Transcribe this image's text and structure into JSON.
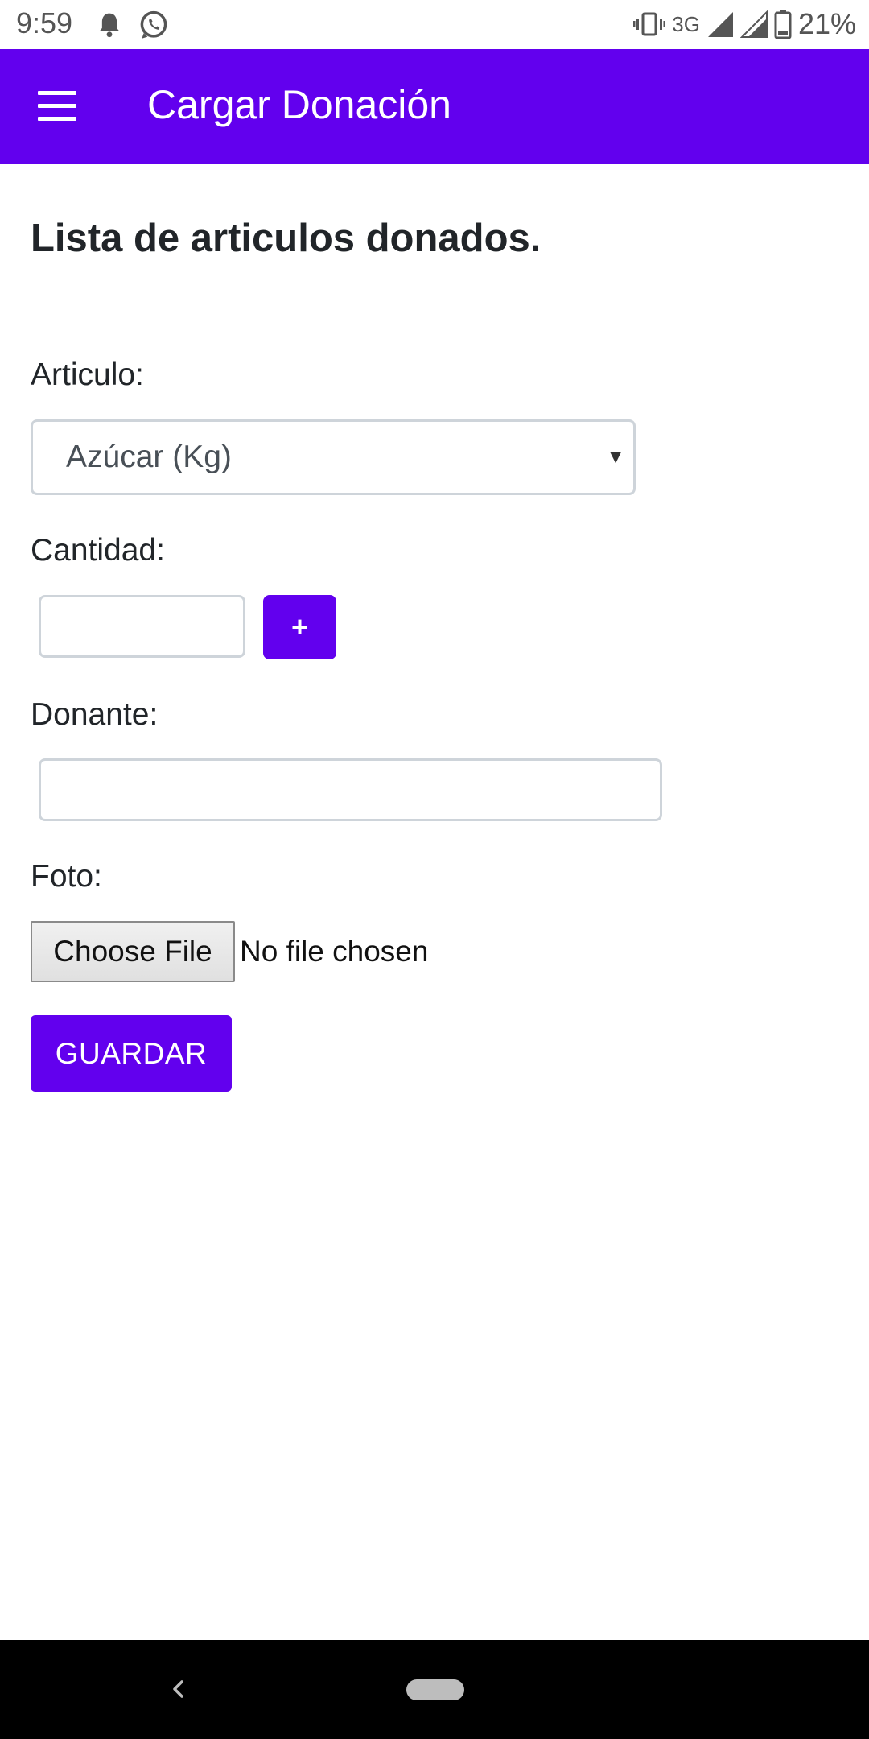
{
  "status_bar": {
    "time": "9:59",
    "network": "3G",
    "battery": "21%",
    "icons": [
      "bell-icon",
      "whatsapp-icon",
      "vibrate-icon",
      "signal-icon",
      "signal-icon",
      "battery-icon"
    ]
  },
  "app_bar": {
    "title": "Cargar Donación",
    "color": "#6200ee",
    "menu_icon": "hamburger-menu-icon"
  },
  "form": {
    "heading": "Lista de articulos donados.",
    "articulo": {
      "label": "Articulo:",
      "selected": "Azúcar (Kg)"
    },
    "cantidad": {
      "label": "Cantidad:",
      "value": "",
      "add_label": "+"
    },
    "donante": {
      "label": "Donante:",
      "value": ""
    },
    "foto": {
      "label": "Foto:",
      "button_label": "Choose File",
      "status": "No file chosen"
    },
    "save_label": "GUARDAR"
  },
  "nav_bar": {
    "icons": [
      "back-icon",
      "home-pill-icon"
    ]
  }
}
